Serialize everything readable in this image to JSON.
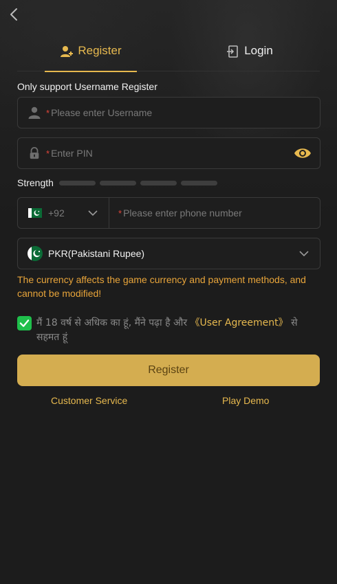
{
  "tabs": {
    "register": "Register",
    "login": "Login"
  },
  "form": {
    "subtitle": "Only support Username Register",
    "username_placeholder": "Please enter Username",
    "pin_placeholder": "Enter PIN",
    "required_mark": "*",
    "strength_label": "Strength",
    "strength_level": 0,
    "country_code": "+92",
    "phone_placeholder": "Please enter phone number",
    "currency": "PKR(Pakistani Rupee)",
    "currency_notice": "The currency affects the game currency and payment methods, and cannot be modified!",
    "agreement_prefix": "मैं 18 वर्ष से अधिक का हूं, मैंने पढ़ा है और ",
    "agreement_link": "《User Agreement》",
    "agreement_suffix": " से सहमत हूं",
    "agreement_checked": true,
    "submit_label": "Register"
  },
  "footer": {
    "customer_service": "Customer Service",
    "play_demo": "Play Demo"
  },
  "colors": {
    "accent": "#e7b94f",
    "button": "#d4ad50",
    "warning": "#e9a53a",
    "check": "#1fbf4b",
    "required": "#e0453a"
  },
  "icons": [
    "back-arrow-icon",
    "user-plus-icon",
    "login-door-icon",
    "user-icon",
    "lock-icon",
    "eye-icon",
    "pakistan-flag-icon",
    "chevron-down-icon",
    "checkmark-icon"
  ]
}
